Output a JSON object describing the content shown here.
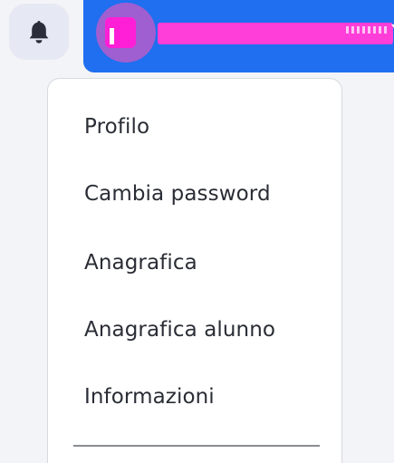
{
  "header": {
    "notifications_icon": "bell-icon",
    "user_menu": {
      "avatar_icon": "avatar",
      "dropdown_icon": "chevron-down-icon",
      "accent_color": "#1f6ff0"
    }
  },
  "menu": {
    "items": [
      {
        "label": "Profilo"
      },
      {
        "label": "Cambia password"
      },
      {
        "label": "Anagrafica"
      },
      {
        "label": "Anagrafica alunno"
      },
      {
        "label": "Informazioni"
      }
    ]
  }
}
